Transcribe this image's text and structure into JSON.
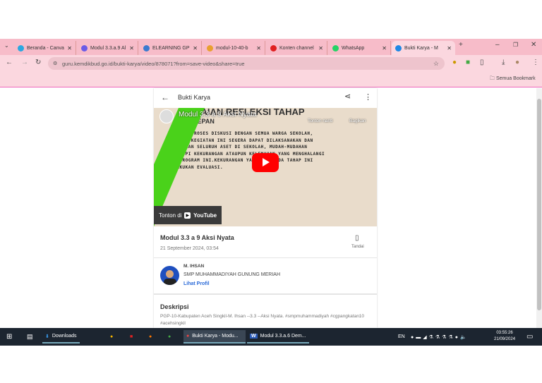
{
  "browser": {
    "tabs": [
      {
        "label": "Beranda - Canva",
        "color": "#2aa8e0"
      },
      {
        "label": "Modul 3.3.a.9 Al",
        "color": "#6b5ce7"
      },
      {
        "label": "ELEARNING GP",
        "color": "#3b7bd0"
      },
      {
        "label": "modul-10-40-b",
        "color": "#e8a030"
      },
      {
        "label": "Konten channel",
        "color": "#e02020"
      },
      {
        "label": "WhatsApp",
        "color": "#25d366"
      },
      {
        "label": "Bukti Karya - M",
        "color": "#1e88e5"
      }
    ],
    "url": "guru.kemdikbud.go.id/bukti-karya/video/878071?from=save-video&share=true",
    "bookmarks_label": "Semua Bookmark"
  },
  "page": {
    "header_title": "Bukti Karya",
    "video": {
      "title": "Modul 3.3 a 9 Aksi Nyata",
      "overlay_heading": "CAPAIAN REFLEKSI TAHAP",
      "overlay_sub": "KE DEPAN",
      "overlay_lines": [
        "MELALUI PROSES DISKUSI DENGAN SEMUA WARGA SEKOLAH,",
        "PROGRAM/KEGIATAN INI SEGERA DAPAT DILAKSANAKAN DAN",
        "MEMADUKAN SELURUH ASET DI SEKOLAH, MUDAH-MUDAHAN",
        "MENUTUPI KEKURANGAN ATAUPUN KELEMAHAN YANG MENGHALANGI",
        "NYA PROGRAM INI.KEKURANGAN YANG ADA PADA TAHAP INI",
        "DILAKUKAN EVALUASI."
      ],
      "watch_later": "Tonton nanti",
      "share": "Bagikan",
      "watch_on": "Tonton di",
      "youtube": "YouTube"
    },
    "post_title": "Modul 3.3 a 9 Aksi Nyata",
    "date": "21 September 2024, 03:54",
    "bookmark_label": "Tandai",
    "author": {
      "name": "M. IHSAN",
      "school": "SMP MUHAMMADIYAH GUNUNG MERIAH",
      "profile_link": "Lihat Profil"
    },
    "description_heading": "Deskripsi",
    "description": "PGP-10-Kabupaten Aceh Singkil-M. Ihsan --3.3 --Aksi Nyata. #smpmuhammadiyah #cgpangkatan10 #acehsingkil"
  },
  "taskbar": {
    "downloads": "Downloads",
    "chrome_window": "Bukti Karya - Modu...",
    "word_window": "Modul 3.3.a.6 Dem...",
    "lang": "EN",
    "time": "03:55:26",
    "date": "21/09/2024"
  }
}
